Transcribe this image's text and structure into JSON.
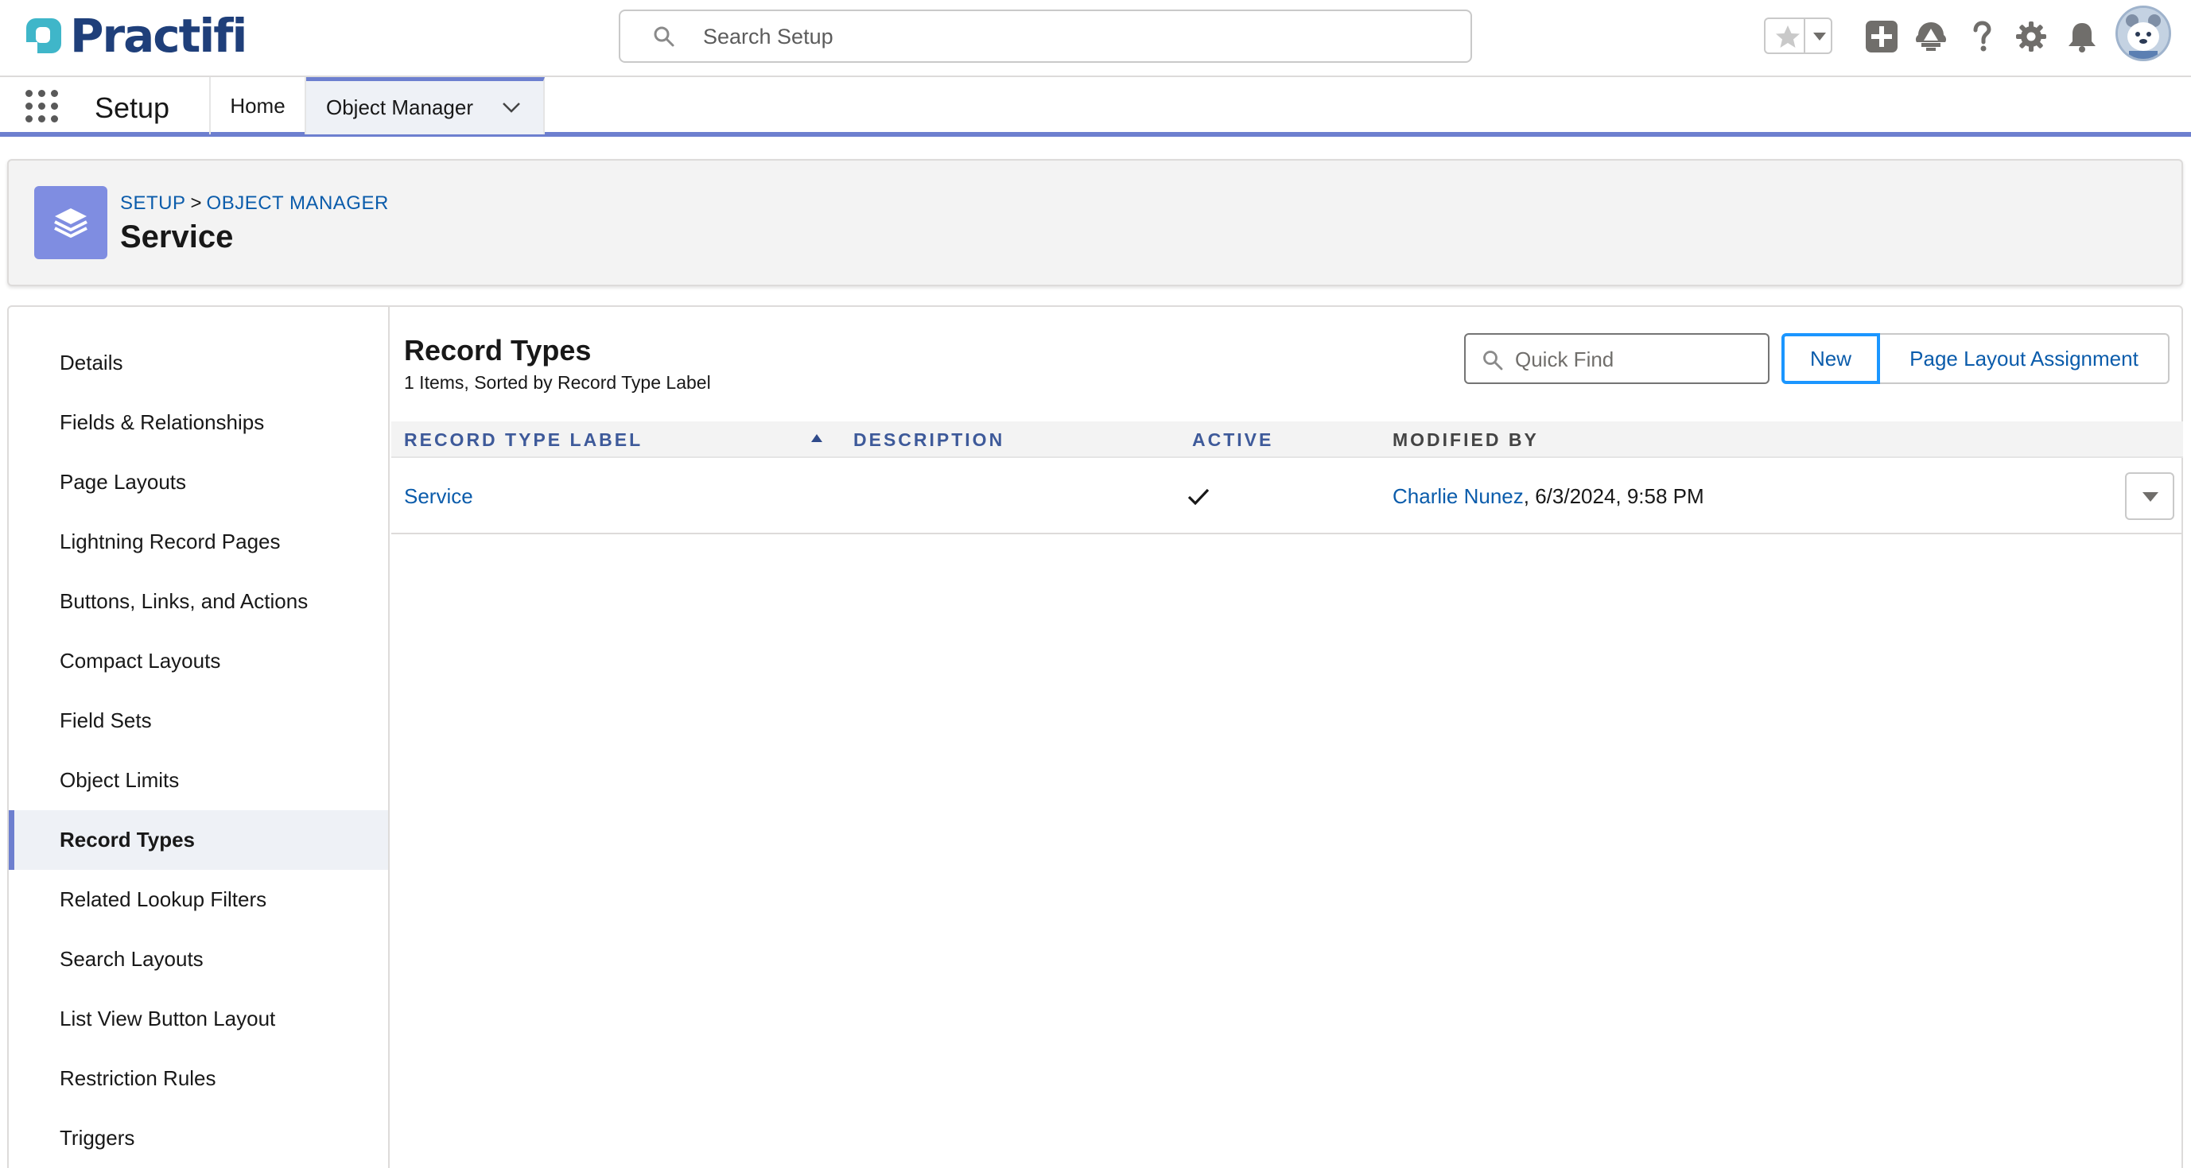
{
  "header": {
    "logo_text": "Practifi",
    "search_placeholder": "Search Setup",
    "icons": [
      "favorites-star-icon",
      "favorites-dropdown-icon",
      "add-icon",
      "trailhead-icon",
      "help-icon",
      "gear-icon",
      "bell-icon",
      "avatar"
    ]
  },
  "context_bar": {
    "app_name": "Setup",
    "tabs": [
      {
        "label": "Home"
      },
      {
        "label": "Object Manager"
      }
    ]
  },
  "page_header": {
    "breadcrumb": [
      "SETUP",
      "OBJECT MANAGER"
    ],
    "breadcrumb_separator": ">",
    "title": "Service"
  },
  "sidebar": {
    "items": [
      {
        "label": "Details"
      },
      {
        "label": "Fields & Relationships"
      },
      {
        "label": "Page Layouts"
      },
      {
        "label": "Lightning Record Pages"
      },
      {
        "label": "Buttons, Links, and Actions"
      },
      {
        "label": "Compact Layouts"
      },
      {
        "label": "Field Sets"
      },
      {
        "label": "Object Limits"
      },
      {
        "label": "Record Types"
      },
      {
        "label": "Related Lookup Filters"
      },
      {
        "label": "Search Layouts"
      },
      {
        "label": "List View Button Layout"
      },
      {
        "label": "Restriction Rules"
      },
      {
        "label": "Triggers"
      }
    ],
    "active_item": "Record Types"
  },
  "content": {
    "title": "Record Types",
    "meta": "1 Items, Sorted by Record Type Label",
    "quick_find_placeholder": "Quick Find",
    "new_button": "New",
    "page_layout_button": "Page Layout Assignment",
    "columns": [
      "RECORD TYPE LABEL",
      "DESCRIPTION",
      "ACTIVE",
      "MODIFIED BY"
    ],
    "rows": [
      {
        "label": "Service",
        "description": "",
        "active": true,
        "modified_by_name": "Charlie Nunez",
        "modified_by_date": ", 6/3/2024, 9:58 PM"
      }
    ]
  },
  "colors": {
    "accent": "#6d7fcf",
    "link": "#0b5cab",
    "brand_navy": "#1f3f7a",
    "brand_teal": "#3fb6c9",
    "focus_blue": "#1b96ff"
  }
}
